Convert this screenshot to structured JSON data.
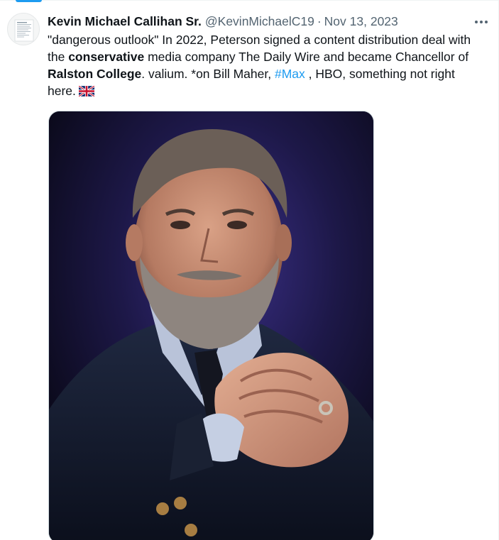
{
  "tweet": {
    "author_name": "Kevin Michael Callihan Sr.",
    "author_handle": "@KevinMichaelC19",
    "separator": "·",
    "timestamp": "Nov 13, 2023",
    "text": {
      "part1": "\"dangerous outlook\" In 2022, Peterson signed a content distribution deal with the ",
      "bold1": "conservative",
      "part2": " media company The Daily Wire and became Chancellor of ",
      "bold2": "Ralston College",
      "part3": ". valium. *on Bill Maher, ",
      "hashtag": "#Max",
      "part4": " , HBO, something not right here."
    }
  },
  "icons": {
    "more": "more-horizontal-icon",
    "flag": "uk-flag-icon",
    "avatar": "document-avatar"
  },
  "colors": {
    "accent": "#1d9bf0",
    "text": "#0f1419",
    "secondary_text": "#536471",
    "border": "#cfd9de"
  }
}
